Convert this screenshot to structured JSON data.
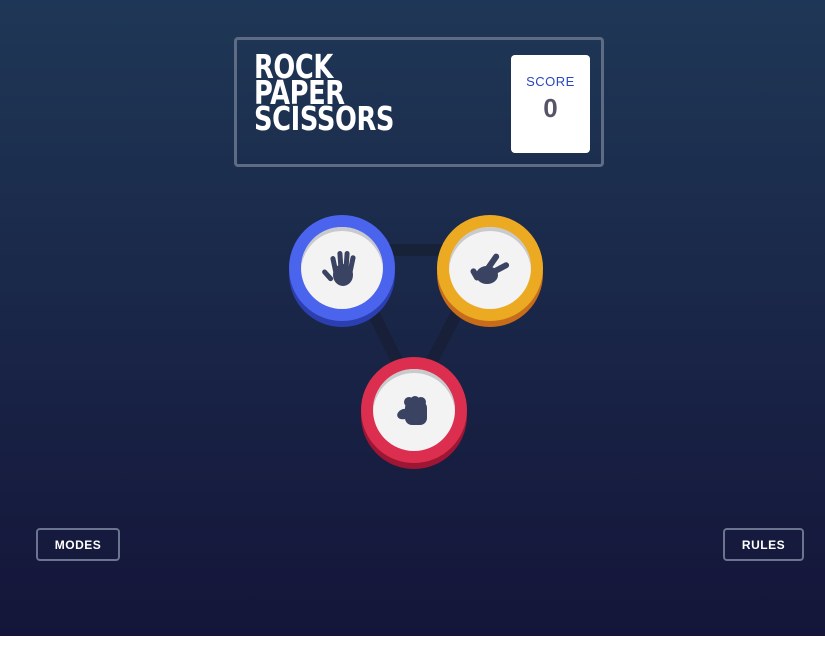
{
  "game": {
    "title_lines": [
      "ROCK",
      "PAPER",
      "SCISSORS"
    ]
  },
  "score": {
    "label": "SCORE",
    "value": "0"
  },
  "choices": [
    {
      "name": "paper",
      "icon": "paper-hand-icon",
      "ring_color": "#4a64ee"
    },
    {
      "name": "scissors",
      "icon": "scissors-hand-icon",
      "ring_color": "#eca922"
    },
    {
      "name": "rock",
      "icon": "rock-fist-icon",
      "ring_color": "#dc2e4e"
    }
  ],
  "buttons": {
    "modes_label": "MODES",
    "rules_label": "RULES"
  },
  "colors": {
    "background_top": "#1f3756",
    "background_bottom": "#141539",
    "score_label": "#2a46c0",
    "score_value": "#565468"
  }
}
